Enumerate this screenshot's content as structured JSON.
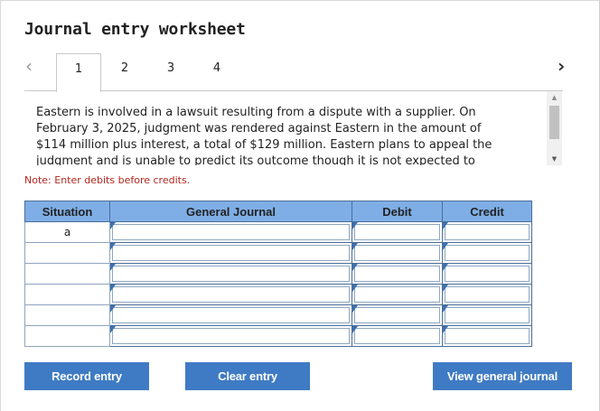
{
  "title": "Journal entry worksheet",
  "nav": {
    "prev_icon": "chevron-left-icon",
    "next_icon": "chevron-right-icon"
  },
  "tabs": [
    {
      "label": "1",
      "active": true
    },
    {
      "label": "2",
      "active": false
    },
    {
      "label": "3",
      "active": false
    },
    {
      "label": "4",
      "active": false
    }
  ],
  "prompt": {
    "line1": "Eastern is involved in a lawsuit resulting from a dispute with a supplier. On",
    "line2": "February 3, 2025, judgment was rendered against Eastern in the amount of",
    "line3": "$114 million plus interest, a total of $129 million. Eastern plans to appeal the",
    "line4": "judgment and is unable to predict its outcome though it is not expected to"
  },
  "note": "Note: Enter debits before credits.",
  "table": {
    "headers": [
      "Situation",
      "General Journal",
      "Debit",
      "Credit"
    ],
    "rows": [
      {
        "situation": "a",
        "account": "",
        "debit": "",
        "credit": ""
      },
      {
        "situation": "",
        "account": "",
        "debit": "",
        "credit": ""
      },
      {
        "situation": "",
        "account": "",
        "debit": "",
        "credit": ""
      },
      {
        "situation": "",
        "account": "",
        "debit": "",
        "credit": ""
      },
      {
        "situation": "",
        "account": "",
        "debit": "",
        "credit": ""
      },
      {
        "situation": "",
        "account": "",
        "debit": "",
        "credit": ""
      }
    ]
  },
  "buttons": {
    "record": "Record entry",
    "clear": "Clear entry",
    "view": "View general journal"
  },
  "colors": {
    "header_bg": "#7faee6",
    "button_bg": "#3f7bc4",
    "note_text": "#b3261e"
  }
}
